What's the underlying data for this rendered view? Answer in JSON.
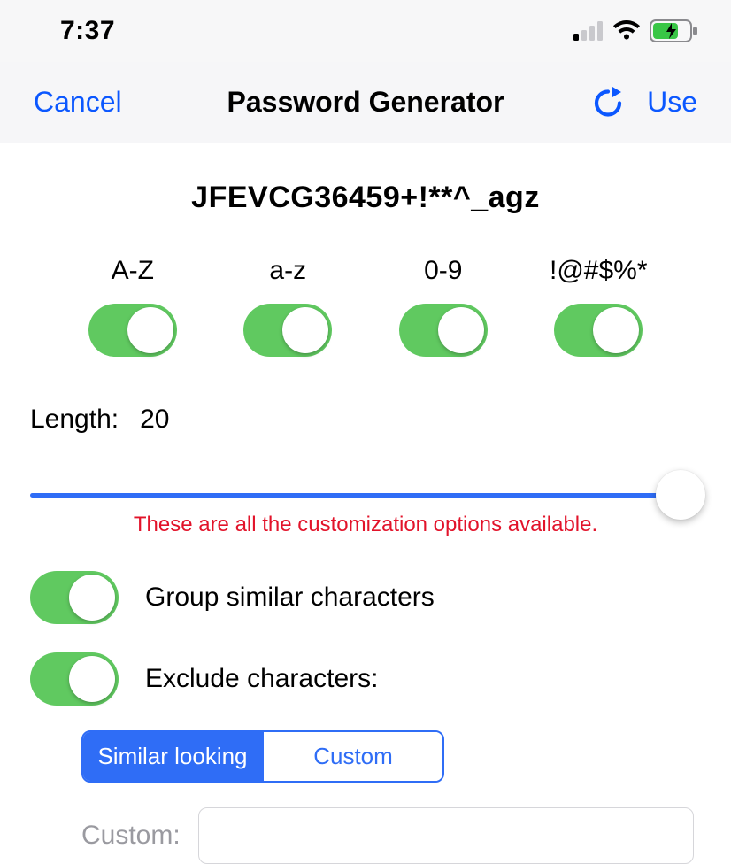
{
  "status": {
    "time": "7:37"
  },
  "nav": {
    "cancel": "Cancel",
    "title": "Password Generator",
    "use": "Use"
  },
  "password": "JFEVCG36459+!**^_agz",
  "charsets": {
    "upper": {
      "label": "A-Z",
      "on": true
    },
    "lower": {
      "label": "a-z",
      "on": true
    },
    "digits": {
      "label": "0-9",
      "on": true
    },
    "symbols": {
      "label": "!@#$%*",
      "on": true
    }
  },
  "length": {
    "label": "Length:",
    "value": "20",
    "percent": 97
  },
  "hint": "These are all the customization options available.",
  "options": {
    "group": {
      "label": "Group similar characters",
      "on": true
    },
    "exclude": {
      "label": "Exclude characters:",
      "on": true
    }
  },
  "exclude_mode": {
    "similar": "Similar looking",
    "custom": "Custom",
    "active": "similar"
  },
  "custom": {
    "label": "Custom:",
    "value": ""
  },
  "colors": {
    "accent": "#2f6df6",
    "toggle_on": "#60c960",
    "danger": "#e2132a"
  }
}
